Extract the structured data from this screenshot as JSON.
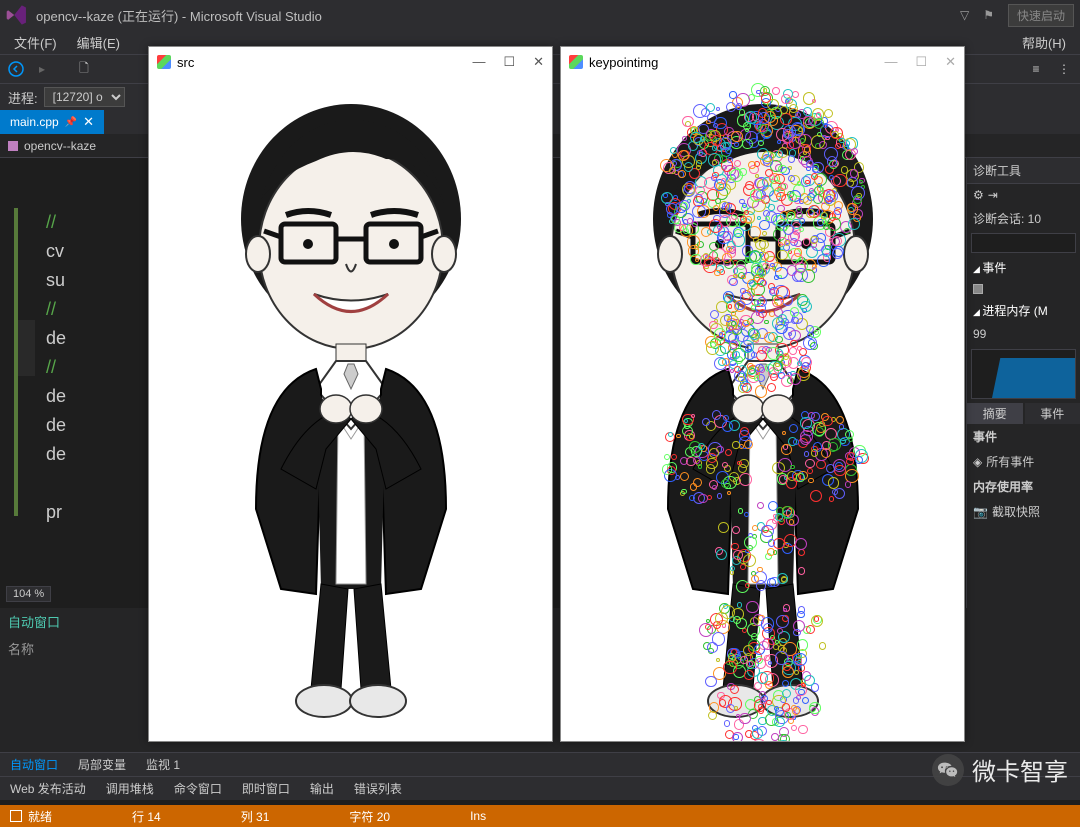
{
  "title": "opencv--kaze (正在运行) - Microsoft Visual Studio",
  "quick": "快速启动",
  "menu": [
    "文件(F)",
    "编辑(E)",
    "帮助(H)"
  ],
  "process_label": "进程:",
  "process_value": "[12720] o",
  "tab": "main.cpp",
  "crumb": "opencv--kaze",
  "zoom": "104 %",
  "code": [
    "//",
    "cv",
    "su",
    "//",
    "de",
    "//",
    "de",
    "de",
    "de",
    "",
    "pr"
  ],
  "diag": {
    "header": "诊断工具",
    "session": "诊断会话: 10",
    "events": "事件",
    "mem_header": "进程内存 (M",
    "mem_val": "99",
    "tabs": [
      "摘要",
      "事件"
    ],
    "events2": "事件",
    "all_events": "所有事件",
    "mem_usage": "内存使用率",
    "snapshot": "截取快照"
  },
  "autos": {
    "header": "自动窗口",
    "name": "名称"
  },
  "autos_tabs": [
    "自动窗口",
    "局部变量",
    "监视 1"
  ],
  "out_tabs": [
    "Web 发布活动",
    "调用堆栈",
    "命令窗口",
    "即时窗口",
    "输出",
    "错误列表"
  ],
  "status": {
    "ready": "就绪",
    "line": "行 14",
    "col": "列 31",
    "char": "字符 20",
    "ins": "Ins"
  },
  "win1": {
    "title": "src"
  },
  "win2": {
    "title": "keypointimg"
  },
  "watermark": "微卡智享"
}
